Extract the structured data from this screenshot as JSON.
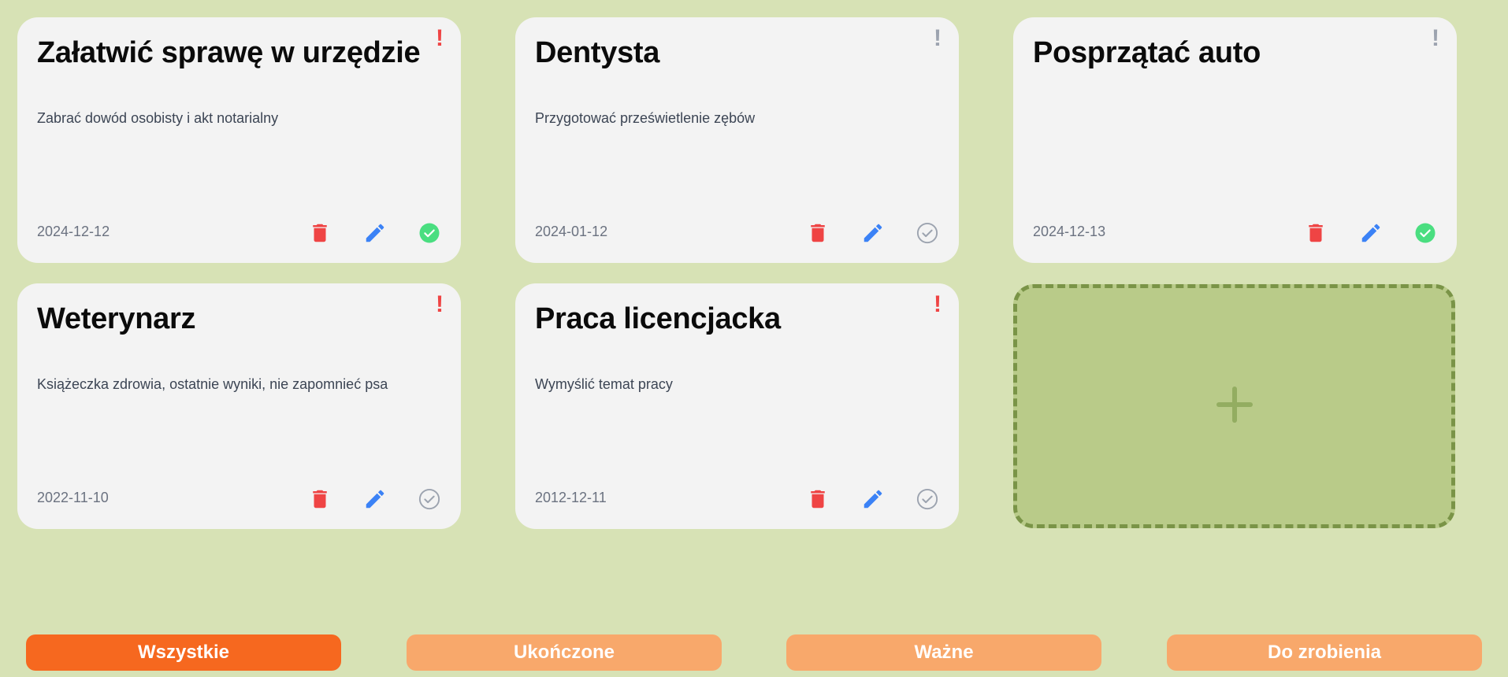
{
  "colors": {
    "background": "#d7e2b5",
    "card": "#f3f3f3",
    "priority_important": "#ef4444",
    "priority_normal": "#9ca3af",
    "delete": "#ef4444",
    "edit": "#3b82f6",
    "done": "#4ade80",
    "not_done": "#9ca3af",
    "add_card_fill": "#b9cb89",
    "add_card_border": "#7a9447",
    "filter_active": "#f6681f",
    "filter_inactive": "#f8a86b"
  },
  "tasks": [
    {
      "title": "Załatwić sprawę w urzędzie",
      "description": "Zabrać dowód osobisty i akt notarialny",
      "date": "2024-12-12",
      "priority_mark": "!",
      "important": true,
      "completed": true
    },
    {
      "title": "Dentysta",
      "description": "Przygotować prześwietlenie zębów",
      "date": "2024-01-12",
      "priority_mark": "!",
      "important": false,
      "completed": false
    },
    {
      "title": "Posprzątać auto",
      "description": "",
      "date": "2024-12-13",
      "priority_mark": "!",
      "important": false,
      "completed": true
    },
    {
      "title": "Weterynarz",
      "description": "Książeczka zdrowia, ostatnie wyniki, nie zapomnieć psa",
      "date": "2022-11-10",
      "priority_mark": "!",
      "important": true,
      "completed": false
    },
    {
      "title": "Praca licencjacka",
      "description": "Wymyślić temat pracy",
      "date": "2012-12-11",
      "priority_mark": "!",
      "important": true,
      "completed": false
    }
  ],
  "icons": {
    "delete": "trash-icon",
    "edit": "pencil-icon",
    "done": "check-circle-icon",
    "add": "plus-icon"
  },
  "filters": [
    {
      "label": "Wszystkie",
      "active": true
    },
    {
      "label": "Ukończone",
      "active": false
    },
    {
      "label": "Ważne",
      "active": false
    },
    {
      "label": "Do zrobienia",
      "active": false
    }
  ]
}
